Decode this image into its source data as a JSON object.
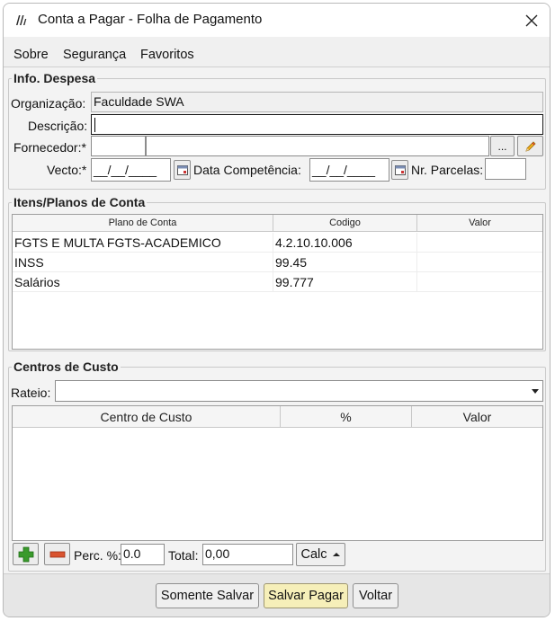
{
  "window": {
    "title": "Conta a Pagar - Folha de Pagamento"
  },
  "icons": {
    "app": "app-logo-icon",
    "close": "close-icon",
    "dots": "ellipsis-icon",
    "edit": "pencil-icon",
    "calendar": "calendar-icon",
    "add": "plus-icon",
    "remove": "minus-icon",
    "calc_arrow": "caret-up-icon",
    "dropdown": "chevron-down-icon"
  },
  "colors": {
    "add_icon": "#3a9a2c",
    "remove_icon": "#d9532f",
    "primary_button": "#f6efb9"
  },
  "menu": {
    "sobre": "Sobre",
    "seguranca": "Segurança",
    "favoritos": "Favoritos"
  },
  "info_despesa": {
    "legend": "Info. Despesa",
    "organizacao_label": "Organização:",
    "organizacao_value": "Faculdade SWA",
    "descricao_label": "Descrição:",
    "descricao_value": "",
    "fornecedor_label": "Fornecedor:*",
    "fornecedor_code": "",
    "fornecedor_name": "",
    "dots_label": "...",
    "vecto_label": "Vecto:*",
    "vecto_value": "__/__/____",
    "competencia_label": "Data Competência:",
    "competencia_value": "__/__/____",
    "parcelas_label": "Nr. Parcelas:",
    "parcelas_value": ""
  },
  "itens": {
    "legend": "Itens/Planos de Conta",
    "columns": [
      "Plano de Conta",
      "Codigo",
      "Valor"
    ],
    "rows": [
      {
        "plano": "FGTS E MULTA FGTS-ACADEMICO",
        "codigo": "4.2.10.10.006",
        "valor": ""
      },
      {
        "plano": "INSS",
        "codigo": "99.45",
        "valor": ""
      },
      {
        "plano": "Salários",
        "codigo": "99.777",
        "valor": ""
      }
    ]
  },
  "centros": {
    "legend": "Centros de Custo",
    "rateio_label": "Rateio:",
    "rateio_value": "",
    "columns": [
      "Centro de Custo",
      "%",
      "Valor"
    ],
    "perc_label": "Perc. %:",
    "perc_value": "0.0",
    "total_label": "Total:",
    "total_value": "0,00",
    "calc_label": "Calc"
  },
  "footer": {
    "somente_salvar": "Somente Salvar",
    "salvar_pagar": "Salvar Pagar",
    "voltar": "Voltar"
  }
}
